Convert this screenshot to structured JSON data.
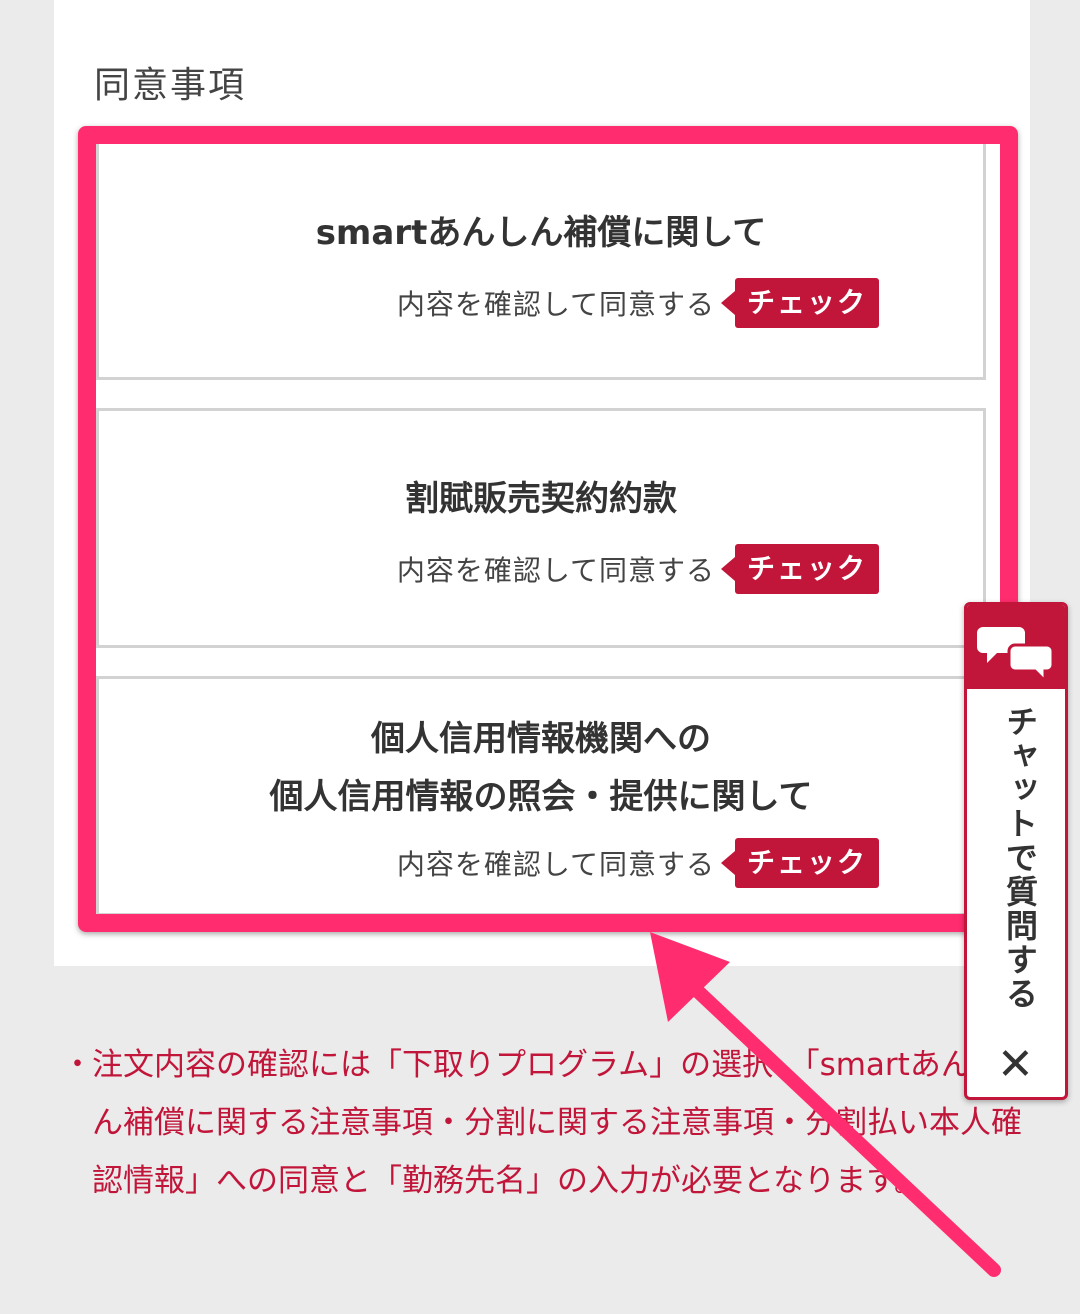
{
  "section": {
    "title": "同意事項"
  },
  "cards": [
    {
      "title_lines": [
        "smartあんしん補償に関して"
      ],
      "consent_text": "内容を確認して同意する",
      "check_label": "チェック"
    },
    {
      "title_lines": [
        "割賦販売契約約款"
      ],
      "consent_text": "内容を確認して同意する",
      "check_label": "チェック"
    },
    {
      "title_lines": [
        "個人信用情報機関への",
        "個人信用情報の照会・提供に関して"
      ],
      "consent_text": "内容を確認して同意する",
      "check_label": "チェック"
    }
  ],
  "note": {
    "bullet": "・",
    "text": "注文内容の確認には「下取りプログラム」の選択、「smartあんしん補償に関する注意事項・分割に関する注意事項・分割払い本人確認情報」への同意と「勤務先名」の入力が必要となります。"
  },
  "chat": {
    "label": "チャットで質問する",
    "close": "✕",
    "icon": "chat-bubbles-icon"
  },
  "colors": {
    "highlight": "#ff2d6f",
    "accent": "#c1163a",
    "background": "#ebebeb"
  }
}
